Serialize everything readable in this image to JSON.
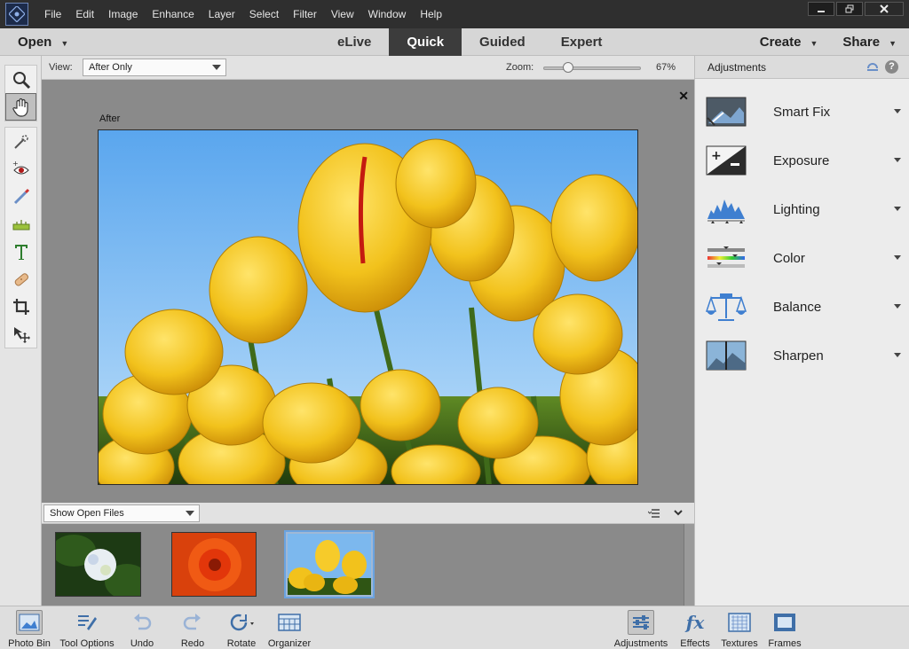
{
  "menubar": {
    "items": [
      "File",
      "Edit",
      "Image",
      "Enhance",
      "Layer",
      "Select",
      "Filter",
      "View",
      "Window",
      "Help"
    ],
    "window_buttons": [
      "minimize",
      "restore",
      "close"
    ]
  },
  "modebar": {
    "open_label": "Open",
    "tabs": [
      {
        "label": "eLive",
        "active": false
      },
      {
        "label": "Quick",
        "active": true
      },
      {
        "label": "Guided",
        "active": false
      },
      {
        "label": "Expert",
        "active": false
      }
    ],
    "create_label": "Create",
    "share_label": "Share"
  },
  "toolbox": {
    "tools": [
      "zoom-tool",
      "hand-tool",
      "quick-selection-tool",
      "red-eye-removal-tool",
      "whiten-teeth-tool",
      "straighten-tool",
      "type-tool",
      "spot-healing-brush-tool",
      "crop-tool",
      "move-tool"
    ],
    "active_tool": "hand-tool"
  },
  "viewbar": {
    "view_label": "View:",
    "view_value": "After Only",
    "zoom_label": "Zoom:",
    "zoom_value": "67%",
    "zoom_percent": 67
  },
  "canvas": {
    "after_label": "After",
    "close_glyph": "✕"
  },
  "photo_bin": {
    "source_value": "Show Open Files",
    "thumbnails": [
      "hydrangea",
      "orange-flower",
      "yellow-tulips"
    ],
    "selected_thumbnail": "yellow-tulips"
  },
  "right_panel": {
    "title": "Adjustments",
    "help_glyph": "?",
    "items": [
      {
        "label": "Smart Fix",
        "icon": "smart-fix-icon"
      },
      {
        "label": "Exposure",
        "icon": "exposure-icon"
      },
      {
        "label": "Lighting",
        "icon": "lighting-icon"
      },
      {
        "label": "Color",
        "icon": "color-icon"
      },
      {
        "label": "Balance",
        "icon": "balance-icon"
      },
      {
        "label": "Sharpen",
        "icon": "sharpen-icon"
      }
    ]
  },
  "bottombar": {
    "left": [
      {
        "label": "Photo Bin",
        "active": true
      },
      {
        "label": "Tool Options",
        "active": false
      },
      {
        "label": "Undo",
        "active": false
      },
      {
        "label": "Redo",
        "active": false
      },
      {
        "label": "Rotate",
        "active": false
      },
      {
        "label": "Organizer",
        "active": false
      }
    ],
    "right": [
      {
        "label": "Adjustments",
        "active": true
      },
      {
        "label": "Effects",
        "active": false
      },
      {
        "label": "Textures",
        "active": false
      },
      {
        "label": "Frames",
        "active": false
      }
    ],
    "effects_glyph": "fx"
  },
  "colors": {
    "menubar_bg": "#2f2f2f",
    "active_tab_bg": "#3c3c3c",
    "canvas_bg": "#8a8a8a",
    "selection_blue": "#6aa3e0"
  }
}
